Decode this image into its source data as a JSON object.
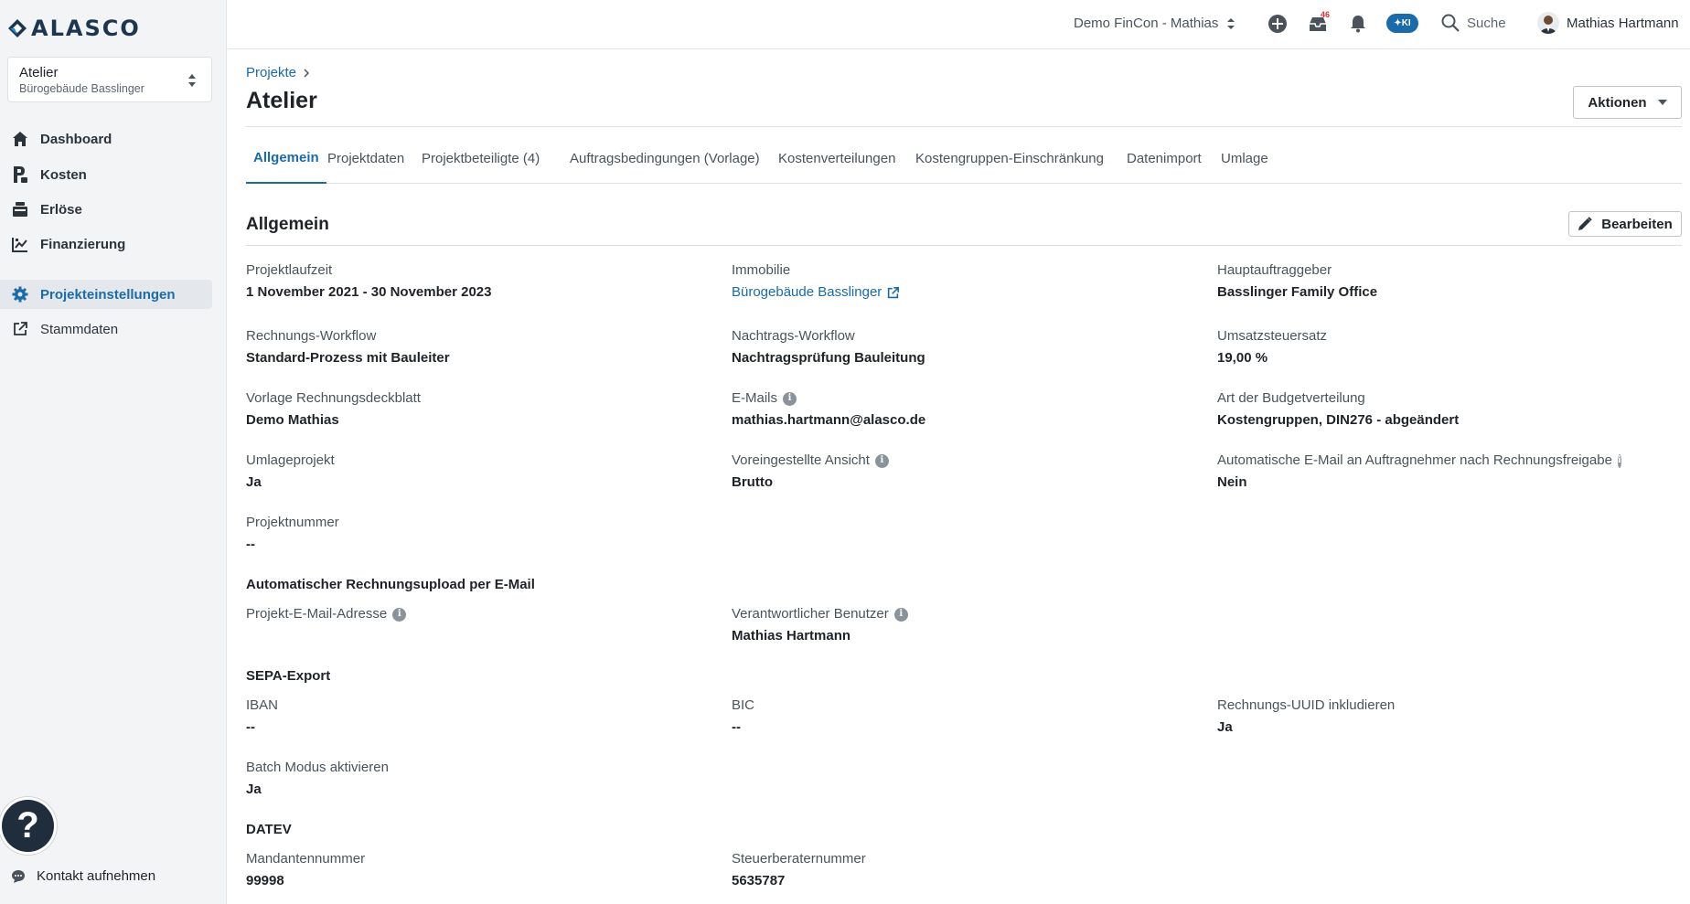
{
  "app": {
    "logo_text": "ALASCO"
  },
  "project_switcher": {
    "name": "Atelier",
    "building": "Bürogebäude Basslinger"
  },
  "sidebar": {
    "items": [
      {
        "label": "Dashboard",
        "icon": "home-icon"
      },
      {
        "label": "Kosten",
        "icon": "cost-icon"
      },
      {
        "label": "Erlöse",
        "icon": "revenue-icon"
      },
      {
        "label": "Finanzierung",
        "icon": "financing-icon"
      },
      {
        "label": "Projekteinstellungen",
        "icon": "gear-icon",
        "active": true
      },
      {
        "label": "Stammdaten",
        "icon": "external-link-icon"
      }
    ],
    "help_label": "?",
    "contact_label": "Kontakt aufnehmen"
  },
  "topbar": {
    "tenant": "Demo FinCon - Mathias",
    "inbox_count": "46",
    "ki_label": "KI",
    "search_label": "Suche",
    "user_name": "Mathias Hartmann"
  },
  "header": {
    "breadcrumb": "Projekte",
    "title": "Atelier",
    "actions_label": "Aktionen"
  },
  "tabs": [
    {
      "label": "Allgemein",
      "active": true
    },
    {
      "label": "Projektdaten"
    },
    {
      "label": "Projektbeteiligte (4)"
    },
    {
      "label": "Auftragsbedingungen (Vorlage)"
    },
    {
      "label": "Kostenverteilungen"
    },
    {
      "label": "Kostengruppen-Einschränkung"
    },
    {
      "label": "Datenimport"
    },
    {
      "label": "Umlage"
    }
  ],
  "section": {
    "title": "Allgemein",
    "edit_label": "Bearbeiten"
  },
  "fields": {
    "projektlaufzeit": {
      "label": "Projektlaufzeit",
      "value": "1 November 2021 - 30 November 2023"
    },
    "immobilie": {
      "label": "Immobilie",
      "value": "Bürogebäude Basslinger"
    },
    "hauptauftraggeber": {
      "label": "Hauptauftraggeber",
      "value": "Basslinger Family Office"
    },
    "rechnungs_workflow": {
      "label": "Rechnungs-Workflow",
      "value": "Standard-Prozess mit Bauleiter"
    },
    "nachtrags_workflow": {
      "label": "Nachtrags-Workflow",
      "value": "Nachtragsprüfung Bauleitung"
    },
    "umsatzsteuersatz": {
      "label": "Umsatzsteuersatz",
      "value": "19,00 %"
    },
    "vorlage": {
      "label": "Vorlage Rechnungsdeckblatt",
      "value": "Demo Mathias"
    },
    "emails": {
      "label": "E-Mails",
      "value": "mathias.hartmann@alasco.de"
    },
    "budgetverteilung": {
      "label": "Art der Budgetverteilung",
      "value": "Kostengruppen, DIN276 - abgeändert"
    },
    "umlageprojekt": {
      "label": "Umlageprojekt",
      "value": "Ja"
    },
    "ansicht": {
      "label": "Voreingestellte Ansicht",
      "value": "Brutto"
    },
    "auto_email": {
      "label": "Automatische E-Mail an Auftragnehmer nach Rechnungsfreigabe",
      "value": "Nein"
    },
    "projektnummer": {
      "label": "Projektnummer",
      "value": "--"
    },
    "projekt_email": {
      "label": "Projekt-E-Mail-Adresse",
      "value": ""
    },
    "verantwortlicher": {
      "label": "Verantwortlicher Benutzer",
      "value": "Mathias Hartmann"
    },
    "iban": {
      "label": "IBAN",
      "value": "--"
    },
    "bic": {
      "label": "BIC",
      "value": "--"
    },
    "uuid": {
      "label": "Rechnungs-UUID inkludieren",
      "value": "Ja"
    },
    "batch": {
      "label": "Batch Modus aktivieren",
      "value": "Ja"
    },
    "mandantennummer": {
      "label": "Mandantennummer",
      "value": "99998"
    },
    "steuerberaternummer": {
      "label": "Steuerberaternummer",
      "value": "5635787"
    }
  },
  "subheads": {
    "upload": "Automatischer Rechnungsupload per E-Mail",
    "sepa": "SEPA-Export",
    "datev": "DATEV"
  },
  "colors": {
    "accent": "#1a6ba8",
    "sidebar_bg": "#f2f4f6",
    "help_bg": "#1f2d3d",
    "alert": "#d83232"
  }
}
